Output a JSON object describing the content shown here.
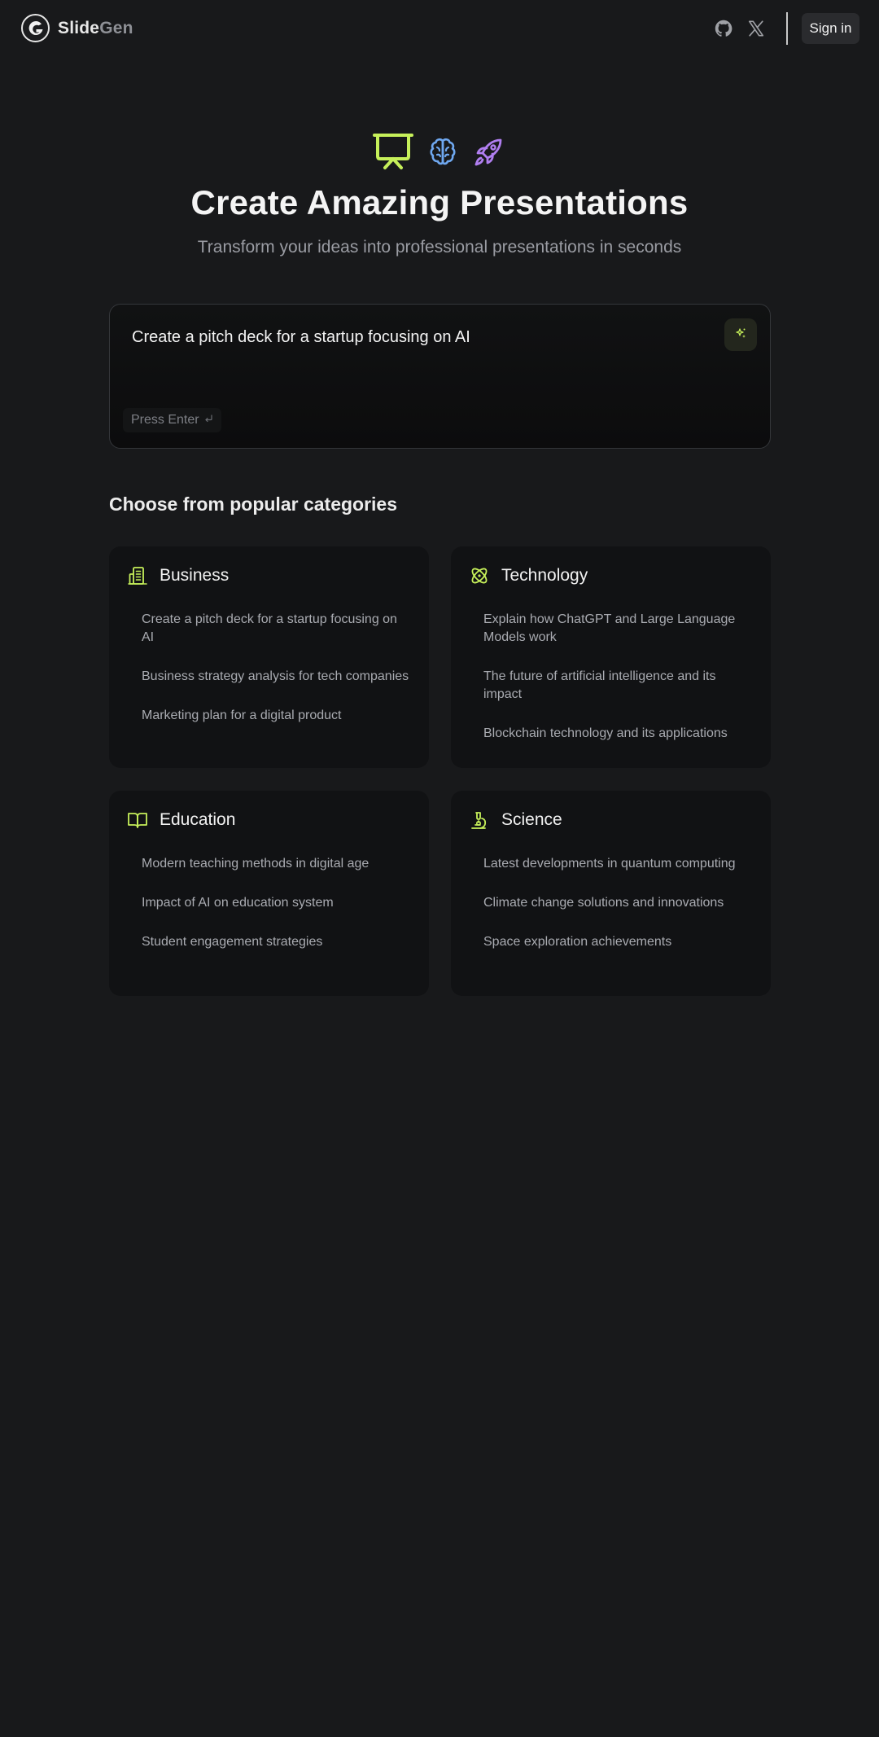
{
  "header": {
    "brand_part1": "Slide",
    "brand_part2": "Gen",
    "github_icon": "github-icon",
    "x_icon": "x-icon",
    "signin_label": "Sign in"
  },
  "hero": {
    "icons": [
      "presentation-icon",
      "brain-icon",
      "rocket-icon"
    ],
    "title": "Create Amazing Presentations",
    "subtitle": "Transform your ideas into professional presentations in seconds"
  },
  "prompt": {
    "value": "Create a pitch deck for a startup focusing on AI",
    "hint": "Press Enter"
  },
  "categories_section": {
    "title": "Choose from popular categories",
    "categories": [
      {
        "name": "Business",
        "icon": "building-icon",
        "items": [
          "Create a pitch deck for a startup focusing on AI",
          "Business strategy analysis for tech companies",
          "Marketing plan for a digital product"
        ]
      },
      {
        "name": "Technology",
        "icon": "atom-icon",
        "items": [
          "Explain how ChatGPT and Large Language Models work",
          "The future of artificial intelligence and its impact",
          "Blockchain technology and its applications"
        ]
      },
      {
        "name": "Education",
        "icon": "book-open-icon",
        "items": [
          "Modern teaching methods in digital age",
          "Impact of AI on education system",
          "Student engagement strategies"
        ]
      },
      {
        "name": "Science",
        "icon": "microscope-icon",
        "items": [
          "Latest developments in quantum computing",
          "Climate change solutions and innovations",
          "Space exploration achievements"
        ]
      }
    ]
  },
  "colors": {
    "background": "#18191b",
    "accent_lime": "#c6f05a",
    "accent_blue": "#6fa8f0",
    "accent_purple": "#b07ef0",
    "card_background": "#111214"
  }
}
